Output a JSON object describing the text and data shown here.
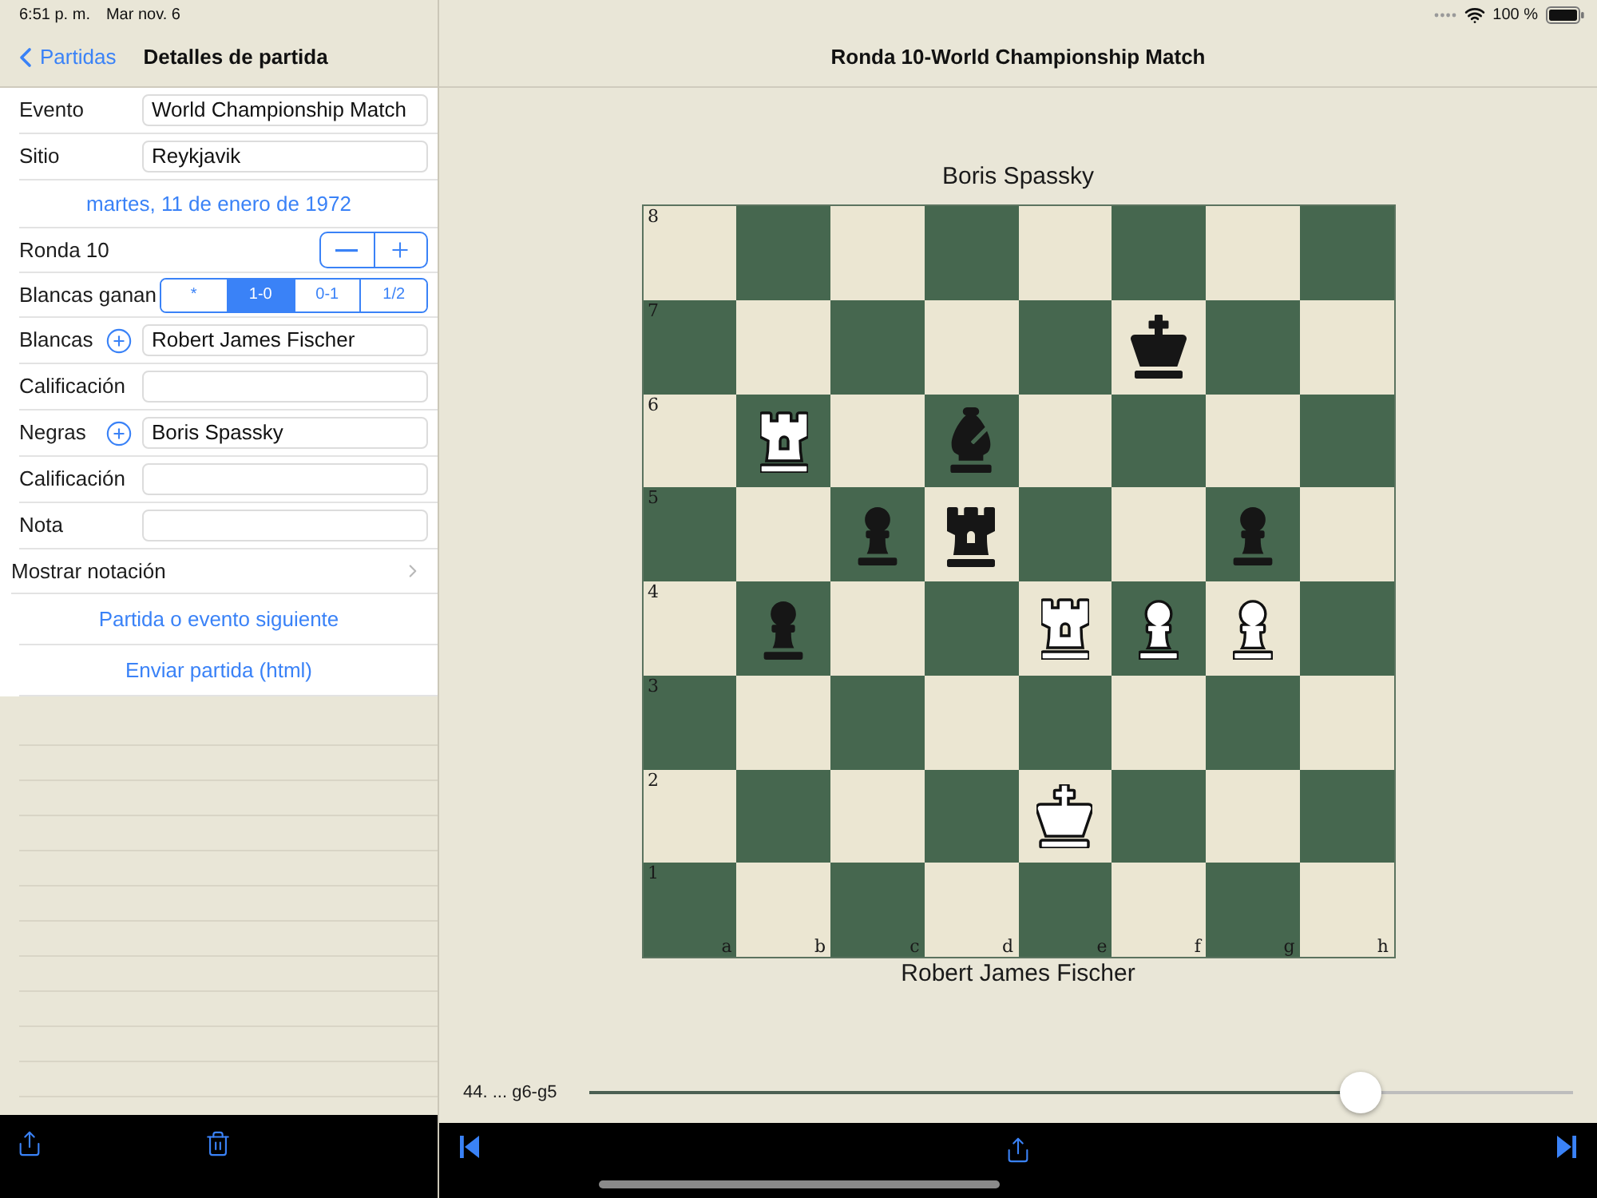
{
  "status_bar": {
    "time": "6:51 p. m.",
    "date": "Mar nov. 6",
    "battery": "100 %"
  },
  "sidebar": {
    "back_button": "Partidas",
    "title": "Detalles de partida",
    "rows": [
      {
        "kind": "text_field",
        "label": "Evento",
        "value": "World Championship Match"
      },
      {
        "kind": "text_field",
        "label": "Sitio",
        "value": "Reykjavik"
      },
      {
        "kind": "date_button",
        "text": "martes, 11 de enero de 1972"
      },
      {
        "kind": "stepper",
        "label": "Ronda 10"
      },
      {
        "kind": "segmented",
        "label": "Blancas ganan",
        "options": [
          {
            "label": "*",
            "selected": false
          },
          {
            "label": "1-0",
            "selected": true
          },
          {
            "label": "0-1",
            "selected": false
          },
          {
            "label": "1/2",
            "selected": false
          }
        ]
      },
      {
        "kind": "player_field",
        "label": "Blancas",
        "value": "Robert James Fischer"
      },
      {
        "kind": "text_field",
        "label": "Calificación"
      },
      {
        "kind": "player_field",
        "label": "Negras",
        "value": "Boris Spassky"
      },
      {
        "kind": "text_field",
        "label": "Calificación"
      },
      {
        "kind": "text_field",
        "label": "Nota"
      },
      {
        "kind": "disclosure",
        "label": "Mostrar notación"
      },
      {
        "kind": "link",
        "text": "Partida o evento siguiente"
      },
      {
        "kind": "link",
        "text": "Enviar partida (html)"
      }
    ]
  },
  "detail": {
    "title": "Ronda 10-World Championship Match",
    "board": {
      "top_player": "Boris Spassky",
      "bottom_player": "Robert James Fischer",
      "files": [
        "a",
        "b",
        "c",
        "d",
        "e",
        "f",
        "g",
        "h"
      ],
      "ranks": [
        {
          "label": "8",
          "squares": [
            {
              "kind": "empty"
            },
            {
              "kind": "empty"
            },
            {
              "kind": "empty"
            },
            {
              "kind": "empty"
            },
            {
              "kind": "empty"
            },
            {
              "kind": "empty"
            },
            {
              "kind": "empty"
            },
            {
              "kind": "empty"
            }
          ]
        },
        {
          "label": "7",
          "squares": [
            {
              "kind": "empty"
            },
            {
              "kind": "empty"
            },
            {
              "kind": "empty"
            },
            {
              "kind": "empty"
            },
            {
              "kind": "empty"
            },
            {
              "kind": "king",
              "white": false
            },
            {
              "kind": "empty"
            },
            {
              "kind": "empty"
            }
          ]
        },
        {
          "label": "6",
          "squares": [
            {
              "kind": "empty"
            },
            {
              "kind": "rook",
              "white": true
            },
            {
              "kind": "empty"
            },
            {
              "kind": "bishop",
              "white": false
            },
            {
              "kind": "empty"
            },
            {
              "kind": "empty"
            },
            {
              "kind": "empty"
            },
            {
              "kind": "empty"
            }
          ]
        },
        {
          "label": "5",
          "squares": [
            {
              "kind": "empty"
            },
            {
              "kind": "empty"
            },
            {
              "kind": "pawn",
              "white": false
            },
            {
              "kind": "rook",
              "white": false
            },
            {
              "kind": "empty"
            },
            {
              "kind": "empty"
            },
            {
              "kind": "pawn",
              "white": false
            },
            {
              "kind": "empty"
            }
          ]
        },
        {
          "label": "4",
          "squares": [
            {
              "kind": "empty"
            },
            {
              "kind": "pawn",
              "white": false
            },
            {
              "kind": "empty"
            },
            {
              "kind": "empty"
            },
            {
              "kind": "rook",
              "white": true
            },
            {
              "kind": "pawn",
              "white": true
            },
            {
              "kind": "pawn",
              "white": true
            },
            {
              "kind": "empty"
            }
          ]
        },
        {
          "label": "3",
          "squares": [
            {
              "kind": "empty"
            },
            {
              "kind": "empty"
            },
            {
              "kind": "empty"
            },
            {
              "kind": "empty"
            },
            {
              "kind": "empty"
            },
            {
              "kind": "empty"
            },
            {
              "kind": "empty"
            },
            {
              "kind": "empty"
            }
          ]
        },
        {
          "label": "2",
          "squares": [
            {
              "kind": "empty"
            },
            {
              "kind": "empty"
            },
            {
              "kind": "empty"
            },
            {
              "kind": "empty"
            },
            {
              "kind": "king",
              "white": true
            },
            {
              "kind": "empty"
            },
            {
              "kind": "empty"
            },
            {
              "kind": "empty"
            }
          ]
        },
        {
          "label": "1",
          "squares": [
            {
              "kind": "empty"
            },
            {
              "kind": "empty"
            },
            {
              "kind": "empty"
            },
            {
              "kind": "empty"
            },
            {
              "kind": "empty"
            },
            {
              "kind": "empty"
            },
            {
              "kind": "empty"
            },
            {
              "kind": "empty"
            }
          ]
        }
      ]
    },
    "move_slider": {
      "move": "44. ... g6-g5",
      "level": 0.784
    }
  }
}
